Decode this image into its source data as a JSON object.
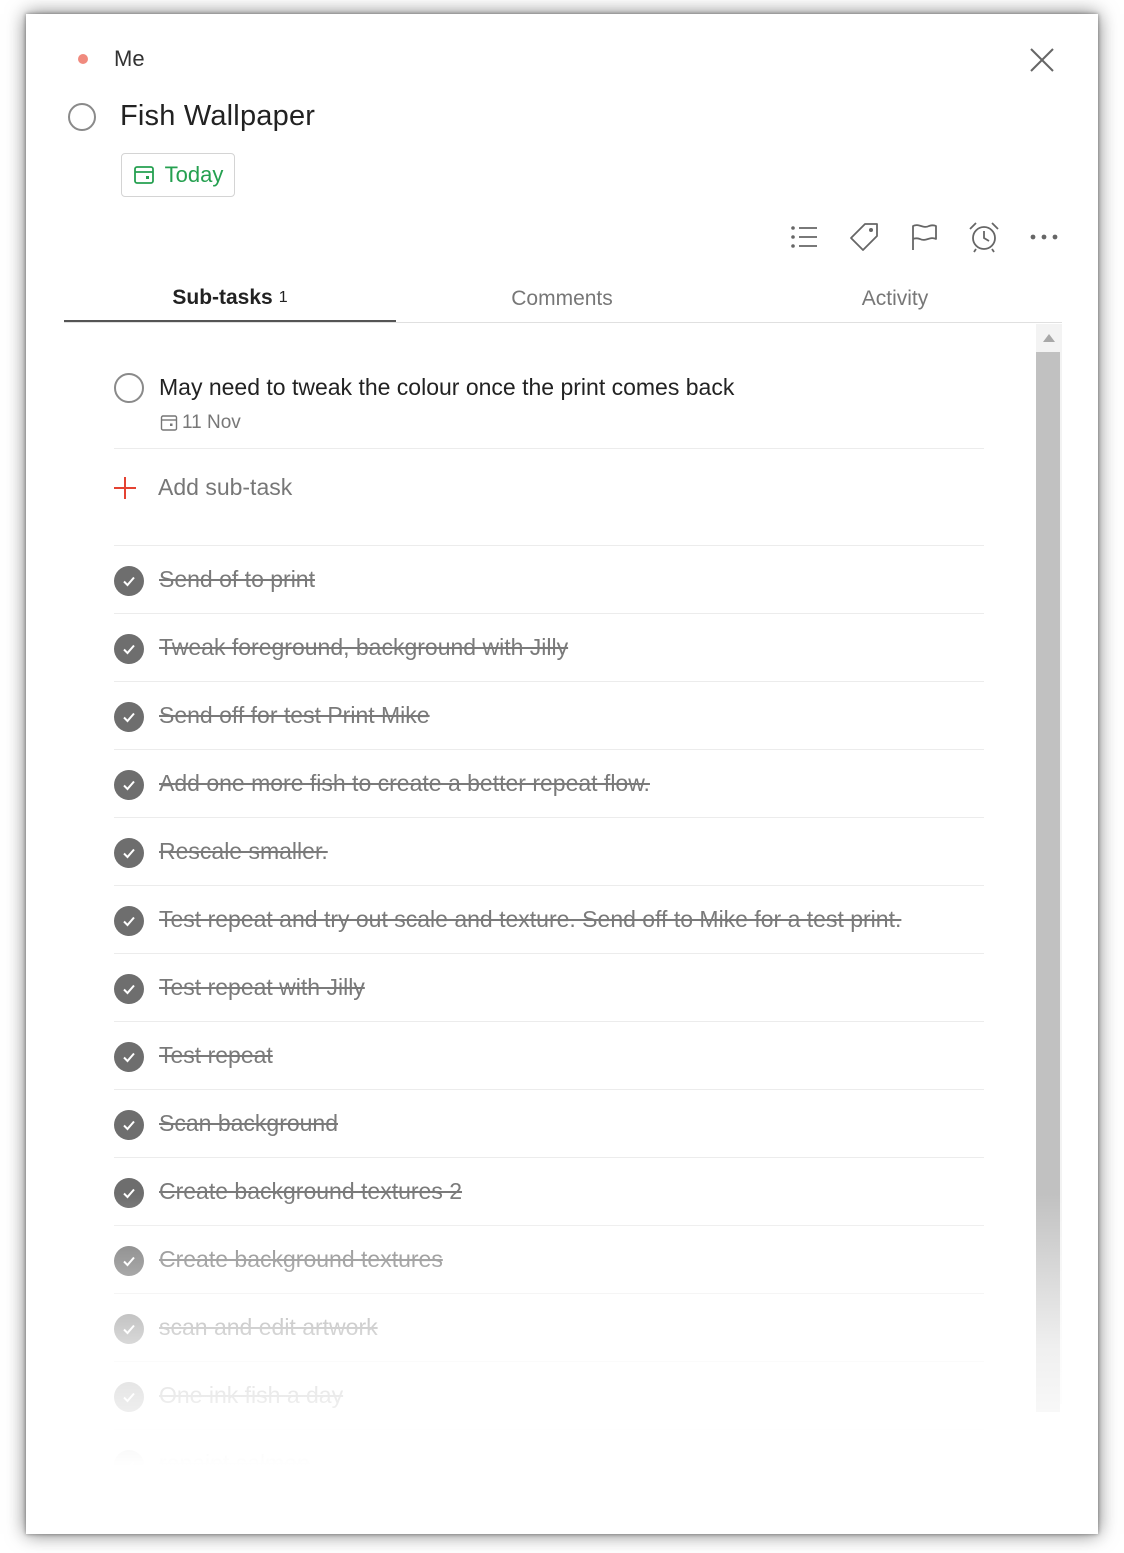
{
  "header": {
    "project_name": "Me",
    "project_color": "#f08a7e",
    "task_title": "Fish Wallpaper",
    "due_label": "Today",
    "due_color": "#25a050"
  },
  "toolbar": {
    "icons": [
      "subtask-list-icon",
      "label-tag-icon",
      "priority-flag-icon",
      "reminder-alarm-icon",
      "more-options-icon"
    ]
  },
  "tabs": {
    "subtasks_label": "Sub-tasks",
    "subtasks_count": "1",
    "comments_label": "Comments",
    "activity_label": "Activity"
  },
  "subtasks": {
    "open": [
      {
        "text": "May need to tweak the colour once the print comes back",
        "date": "11 Nov"
      }
    ],
    "add_label": "Add sub-task",
    "completed": [
      {
        "text": "Send of to print"
      },
      {
        "text": "Tweak foreground, background with Jilly"
      },
      {
        "text": "Send off for test Print Mike"
      },
      {
        "text": "Add one more fish to create a better repeat flow."
      },
      {
        "text": "Rescale smaller."
      },
      {
        "text": "Test repeat and try out scale and texture. Send off to Mike for a test print."
      },
      {
        "text": "Test repeat with Jilly"
      },
      {
        "text": "Test repeat"
      },
      {
        "text": "Scan background"
      },
      {
        "text": "Create background textures 2"
      },
      {
        "text": "Create background textures"
      },
      {
        "text": "scan and edit artwork"
      },
      {
        "text": "One ink fish a day"
      },
      {
        "text": "repaint salmon"
      }
    ]
  },
  "accent_red": "#e44232"
}
